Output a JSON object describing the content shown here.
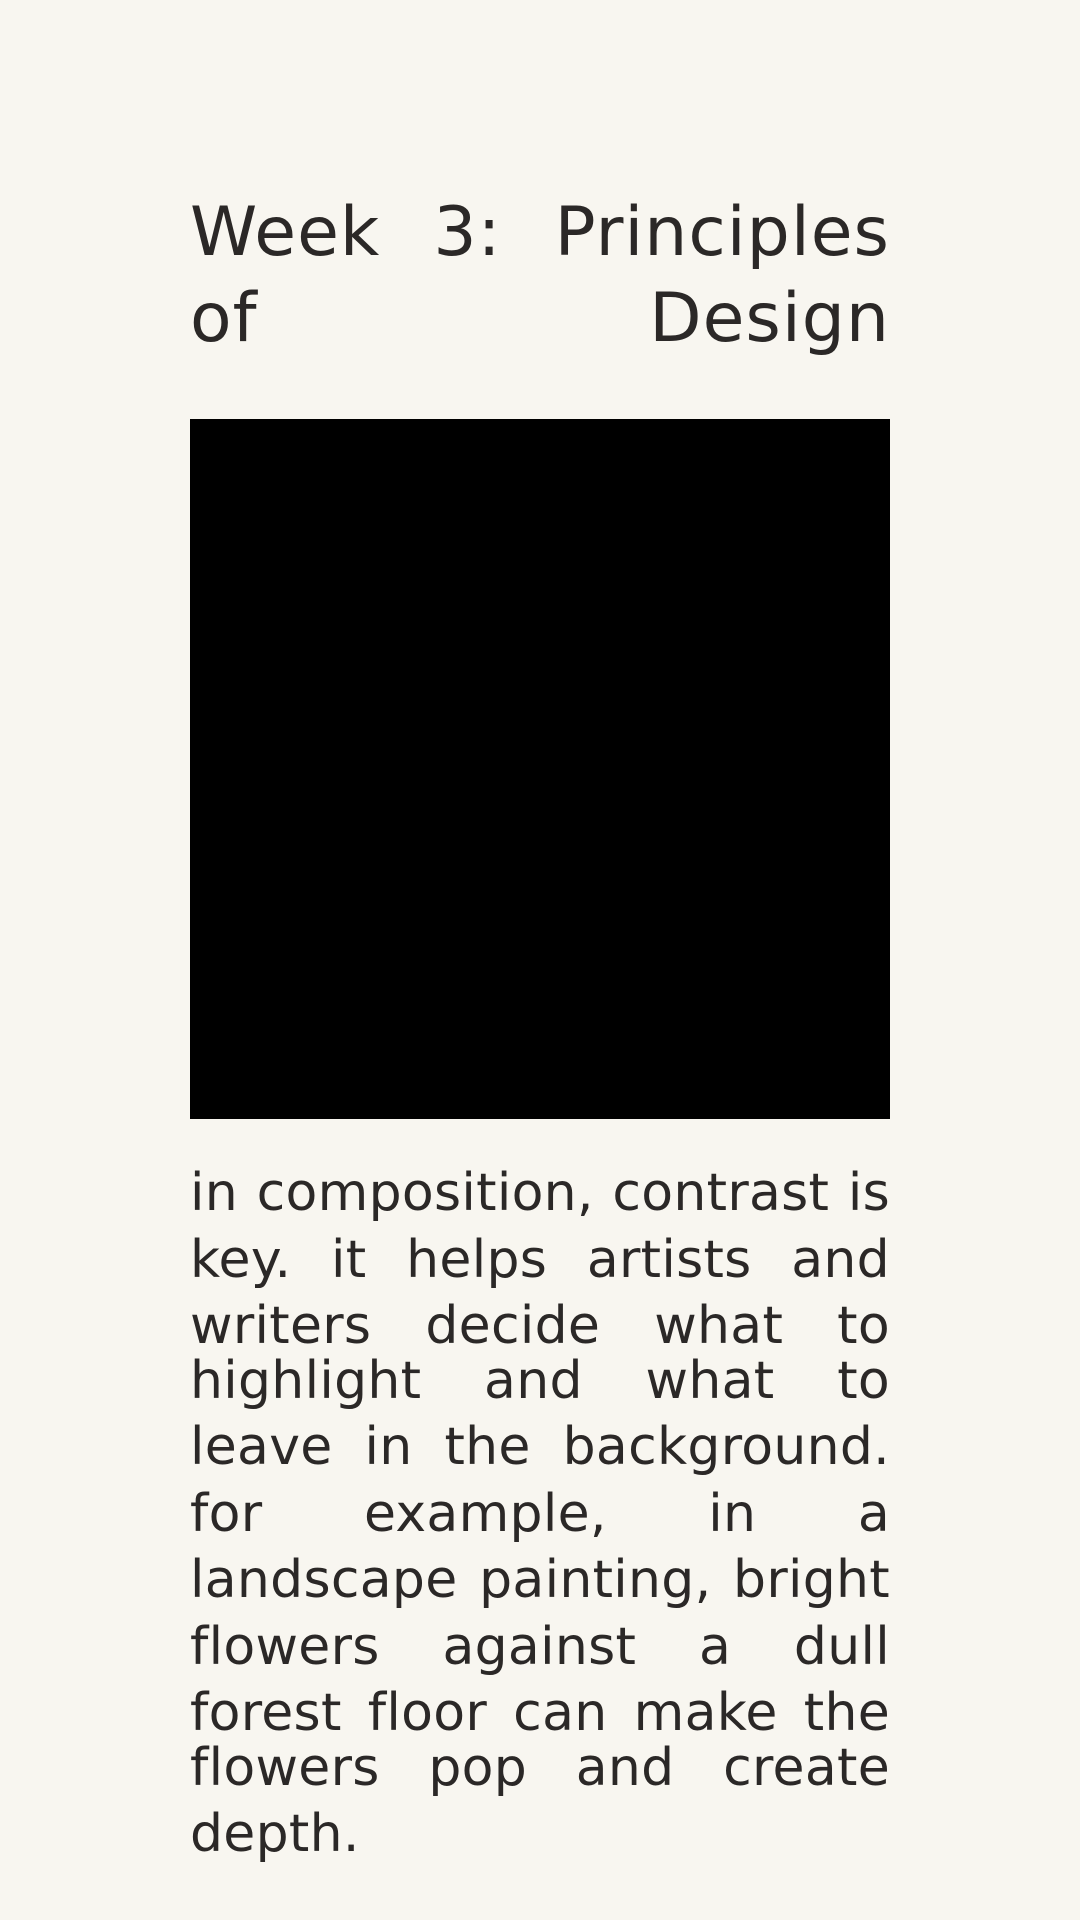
{
  "page": {
    "title_lines": [
      "Week 3: Principles",
      "of Design"
    ],
    "title": "Week 3: Principles of Design",
    "image": {
      "color": "#000000"
    },
    "body": "in composition, contrast is key. it helps artists and writers decide what to highlight and what to leave in the background. for example, in a landscape painting, bright flowers against a dull forest floor can make the flowers pop and create depth.",
    "body_lines": [
      "in composition, contrast is",
      "key. it helps artists and",
      "writers decide what to",
      "highlight and what to",
      "leave in the background.",
      "for example, in a",
      "landscape painting, bright",
      "flowers against a dull",
      "forest floor can make the",
      "flowers pop and create",
      "depth."
    ]
  },
  "colors": {
    "background": "#f8f6f0",
    "text": "#2b2827"
  }
}
